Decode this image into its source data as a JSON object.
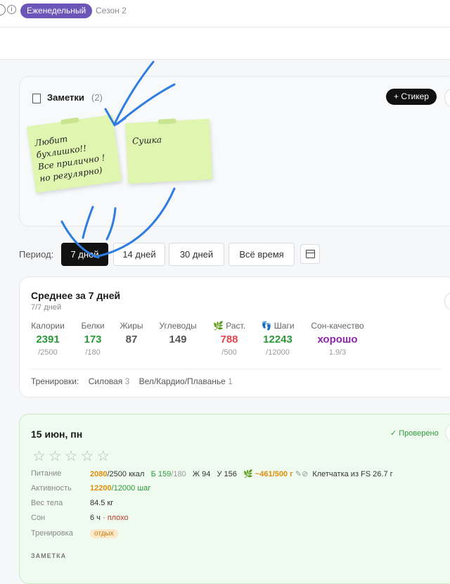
{
  "header": {
    "badge": "Еженедельный",
    "season": "Сезон 2",
    "info_icon": "info-icon"
  },
  "notes": {
    "title": "Заметки",
    "count": "(2)",
    "add_button": "+ Стикер",
    "stickers": [
      {
        "lines": [
          "Любит",
          "бухлишко!!",
          "Все прилично !",
          "но регулярно)"
        ]
      },
      {
        "lines": [
          "Сушка"
        ]
      }
    ]
  },
  "period": {
    "label": "Период:",
    "options": [
      "7 дней",
      "14 дней",
      "30 дней",
      "Всё время"
    ],
    "selected": "7 дней"
  },
  "average": {
    "title": "Среднее за 7 дней",
    "subtitle": "7/7 дней",
    "metrics": [
      {
        "label": "Калории",
        "value": "2391",
        "goal": "/2500",
        "color": "#2c9a3a"
      },
      {
        "label": "Белки",
        "value": "173",
        "goal": "/180",
        "color": "#2c9a3a"
      },
      {
        "label": "Жиры",
        "value": "87",
        "goal": "",
        "color": "#555555"
      },
      {
        "label": "Углеводы",
        "value": "149",
        "goal": "",
        "color": "#555555"
      },
      {
        "label": "Раст.",
        "icon": "leaf-icon",
        "value": "788",
        "goal": "/500",
        "color": "#e0474c"
      },
      {
        "label": "Шаги",
        "icon": "footprints-icon",
        "value": "12243",
        "goal": "/12000",
        "color": "#2c9a3a"
      },
      {
        "label": "Сон-качество",
        "value": "хорошо",
        "goal": "1.9/3",
        "color": "#8e24aa"
      }
    ],
    "trainings_label": "Тренировки:",
    "trainings": [
      {
        "name": "Силовая",
        "count": "3"
      },
      {
        "name": "Вел/Кардио/Плаванье",
        "count": "1"
      }
    ]
  },
  "day": {
    "title": "15 июн, пн",
    "status": "✓ Проверено",
    "rating": 0,
    "nutrition_label": "Питание",
    "calories": "2080",
    "calories_goal": "/2500 ккал",
    "protein": "Б 159",
    "protein_goal": "/180",
    "fat": "Ж 94",
    "carbs": "У 156",
    "plants": "~461",
    "plants_goal": "/500 г",
    "fiber": "Клетчатка из FS 26.7 г",
    "activity_label": "Активность",
    "steps": "12200",
    "steps_goal": "/12000 шаг",
    "weight_label": "Вес тела",
    "weight": "84.5 кг",
    "sleep_label": "Сон",
    "sleep": "6 ч",
    "sleep_quality": "· плохо",
    "training_label": "Тренировка",
    "training": "отдых",
    "note_label": "ЗАМЕТКА"
  }
}
